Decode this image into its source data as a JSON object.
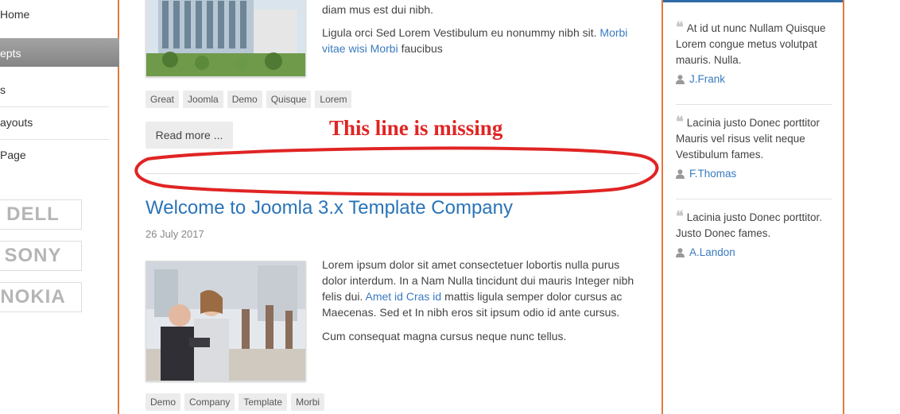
{
  "sidebar": {
    "items": [
      {
        "label": "Home"
      },
      {
        "label": "epts"
      },
      {
        "label": "s"
      },
      {
        "label": "ayouts"
      },
      {
        "label": "Page"
      }
    ],
    "logos": [
      "DELL",
      "SONY",
      "NOKIA"
    ]
  },
  "article1": {
    "text_line": "diam mus est dui nibh.",
    "para2_start": "Ligula orci Sed Lorem Vestibulum eu nonummy nibh sit. ",
    "para2_link": "Morbi vitae wisi Morbi",
    "para2_end": " faucibus",
    "tags": [
      "Great",
      "Joomla",
      "Demo",
      "Quisque",
      "Lorem"
    ],
    "read_more": "Read more ..."
  },
  "annotation": {
    "text": "This line is missing",
    "color": "#e02424"
  },
  "article2": {
    "title": "Welcome to Joomla 3.x Template Company",
    "date": "26 July 2017",
    "para1_start": "Lorem ipsum dolor sit amet consectetuer lobortis nulla purus dolor interdum. In a Nam Nulla tincidunt dui mauris Integer nibh felis dui. ",
    "para1_link": "Amet id Cras id",
    "para1_end": " mattis ligula semper dolor cursus ac Maecenas. Sed et In nibh eros sit ipsum odio id ante cursus.",
    "para2": "Cum consequat magna cursus neque nunc tellus.",
    "tags": [
      "Demo",
      "Company",
      "Template",
      "Morbi"
    ]
  },
  "testimonials": [
    {
      "text": "At id ut nunc Nullam Quisque Lorem congue metus volutpat mauris. Nulla.",
      "author": "J.Frank"
    },
    {
      "text": "Lacinia justo Donec porttitor Mauris vel risus velit neque Vestibulum fames.",
      "author": "F.Thomas"
    },
    {
      "text": "Lacinia justo Donec porttitor. Justo Donec fames.",
      "author": "A.Landon"
    }
  ],
  "colors": {
    "accent": "#e57a3b",
    "link": "#3a7bbf",
    "title": "#2a74b8",
    "top_bar": "#2f6aa6"
  }
}
